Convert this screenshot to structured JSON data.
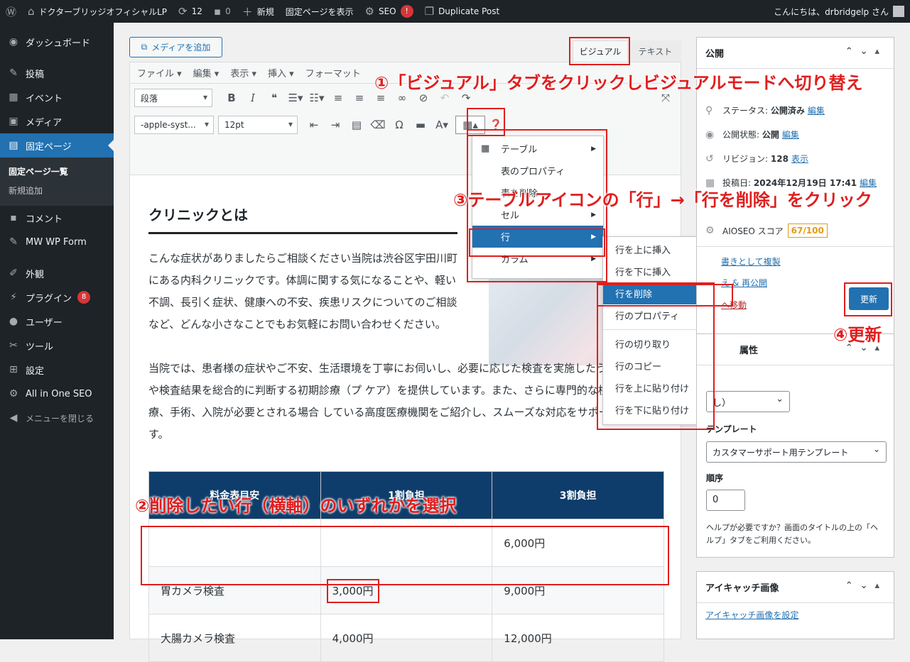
{
  "adminbar": {
    "site_name": "ドクターブリッジオフィシャルLP",
    "updates": "12",
    "comments": "0",
    "new": "新規",
    "view_page": "固定ページを表示",
    "seo": "SEO",
    "seo_badge": "!",
    "duplicate": "Duplicate Post",
    "howdy": "こんにちは、drbridgelp さん"
  },
  "sidebar": {
    "items": [
      {
        "label": "ダッシュボード",
        "icon": "dashboard-icon"
      },
      {
        "label": "投稿",
        "icon": "pin-icon"
      },
      {
        "label": "イベント",
        "icon": "calendar-icon"
      },
      {
        "label": "メディア",
        "icon": "media-icon"
      },
      {
        "label": "固定ページ",
        "icon": "page-icon"
      },
      {
        "label": "コメント",
        "icon": "comment-icon"
      },
      {
        "label": "MW WP Form",
        "icon": "pin-icon"
      },
      {
        "label": "外観",
        "icon": "brush-icon"
      },
      {
        "label": "プラグイン",
        "icon": "plugin-icon",
        "badge": "8"
      },
      {
        "label": "ユーザー",
        "icon": "user-icon"
      },
      {
        "label": "ツール",
        "icon": "wrench-icon"
      },
      {
        "label": "設定",
        "icon": "settings-icon"
      },
      {
        "label": "All in One SEO",
        "icon": "seo-icon"
      },
      {
        "label": "メニューを閉じる",
        "icon": "collapse-icon"
      }
    ],
    "submenu": [
      "固定ページ一覧",
      "新規追加"
    ]
  },
  "editor": {
    "add_media": "メディアを追加",
    "tab_visual": "ビジュアル",
    "tab_text": "テキスト",
    "menubar": [
      "ファイル ▾",
      "編集 ▾",
      "表示 ▾",
      "挿入 ▾",
      "フォーマット"
    ],
    "format_select": "段落",
    "font_select": "-apple-syst...",
    "size_select": "12pt",
    "heading": "クリニックとは",
    "para1": "こんな症状がありましたらご相談ください当院は渋谷区宇田川町にある内科クリニックです。体調に関する気になることや、軽い不調、長引く症状、健康への不安、疾患リスクについてのご相談など、どんな小さなことでもお気軽にお問い合わせください。",
    "para2": "当院では、患者様の症状やご不安、生活環境を丁寧にお伺いし、必要に応じた検査を実施したうえで、問診や検査結果を総合的に判断する初期診療（プ ケア）を提供しています。また、さらに専門的な検査や治療、手術、入院が必要とされる場合 している高度医療機関をご紹介し、スムーズな対応をサポートします。",
    "table": {
      "headers": [
        "料金表目安",
        "1割負担",
        "3割負担"
      ],
      "rows": [
        [
          "",
          "",
          "6,000円"
        ],
        [
          "胃カメラ検査",
          "3,000円",
          "9,000円"
        ],
        [
          "大腸カメラ検査",
          "4,000円",
          "12,000円"
        ]
      ]
    }
  },
  "table_menu": {
    "items": [
      "テーブル",
      "表のプロパティ",
      "表を削除",
      "セル",
      "行",
      "カラム"
    ],
    "row_submenu": [
      "行を上に挿入",
      "行を下に挿入",
      "行を削除",
      "行のプロパティ",
      "行の切り取り",
      "行のコピー",
      "行を上に貼り付け",
      "行を下に貼り付け"
    ]
  },
  "publish": {
    "title": "公開",
    "status_label": "ステータス:",
    "status_value": "公開済み",
    "visibility_label": "公開状態:",
    "visibility_value": "公開",
    "revision_label": "リビジョン:",
    "revision_value": "128",
    "revision_link": "表示",
    "date_label": "投稿日:",
    "date_value": "2024年12月19日 17:41",
    "edit": "編集",
    "aioseo_label": "AIOSEO スコア",
    "aioseo_score": "67/100",
    "copy_draft": "書きとして複製",
    "rewrite": "え & 再公開",
    "trash": "へ移動",
    "update": "更新"
  },
  "attributes": {
    "title": "属性",
    "parent_value": "し）",
    "template_label": "テンプレート",
    "template_value": "カスタマーサポート用テンプレート",
    "order_label": "順序",
    "order_value": "0",
    "help": "ヘルプが必要ですか？画面のタイトルの上の「ヘルプ」タブをご利用ください。"
  },
  "thumbnail": {
    "title": "アイキャッチ画像",
    "set_link": "アイキャッチ画像を設定"
  },
  "annotations": {
    "step1": "①「ビジュアル」タブをクリックしビジュアルモードへ切り替え",
    "step2": "②削除したい行（横軸）のいずれかを選択",
    "step3": "③テーブルアイコンの「行」→「行を削除」をクリック",
    "step4": "④更新"
  },
  "colors": {
    "annotation": "#e01e1e",
    "accent": "#2271b1",
    "table_header": "#0f3d6b"
  }
}
